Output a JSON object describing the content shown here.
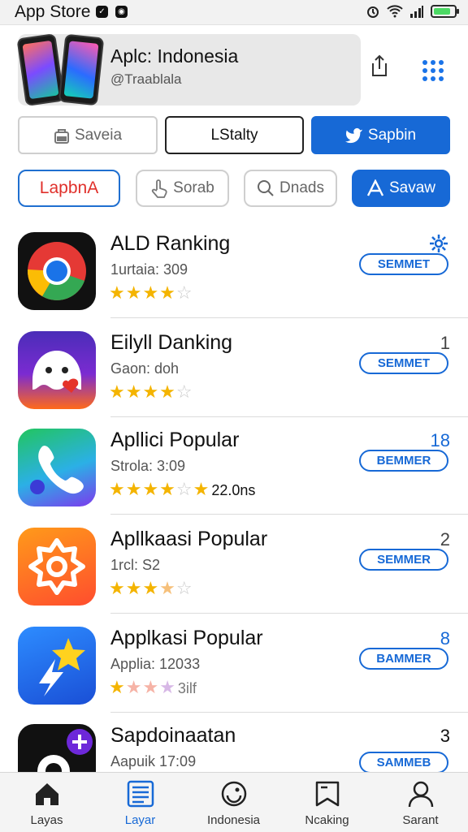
{
  "status_bar": {
    "app_name": "App Store"
  },
  "banner": {
    "title": "Aplc: Indonesia",
    "handle": "@Traablala"
  },
  "buttons_row1": [
    "Saveia",
    "LStalty",
    "Sapbin"
  ],
  "buttons_row2": [
    "LapbnA",
    "Sorab",
    "Dnads",
    "Savaw"
  ],
  "apps": [
    {
      "name": "ALD Ranking",
      "sub": "1urtaia: 309",
      "rating": 4,
      "rank": "",
      "action": "SEMMET"
    },
    {
      "name": "Eilyll Danking",
      "sub": "Gaon: doh",
      "rating": 4,
      "rank": "1",
      "action": "SEMMET"
    },
    {
      "name": "Apllici Popular",
      "sub": "Strola: 3:09",
      "rating": 4,
      "rating_extra": "22.0ns",
      "rank": "18",
      "action": "BEMMER"
    },
    {
      "name": "Apllkaasi Popular",
      "sub": "1rcl: S2",
      "rating": 3,
      "rank": "2",
      "action": "SEMMER"
    },
    {
      "name": "Applkasi Popular",
      "sub": "Applia: 12033",
      "rating": 1,
      "rating_extra": "3ilf",
      "rank": "8",
      "action": "BAMMER"
    },
    {
      "name": "Sapdoinaatan",
      "sub": "Aapuik 17:09",
      "rating": 0,
      "rank": "3",
      "action": "SAMMEB"
    }
  ],
  "tabs": [
    "Layas",
    "Layar",
    "Indonesia",
    "Ncaking",
    "Sarant"
  ],
  "colors": {
    "accent": "#1769d6",
    "star": "#f4b400"
  }
}
